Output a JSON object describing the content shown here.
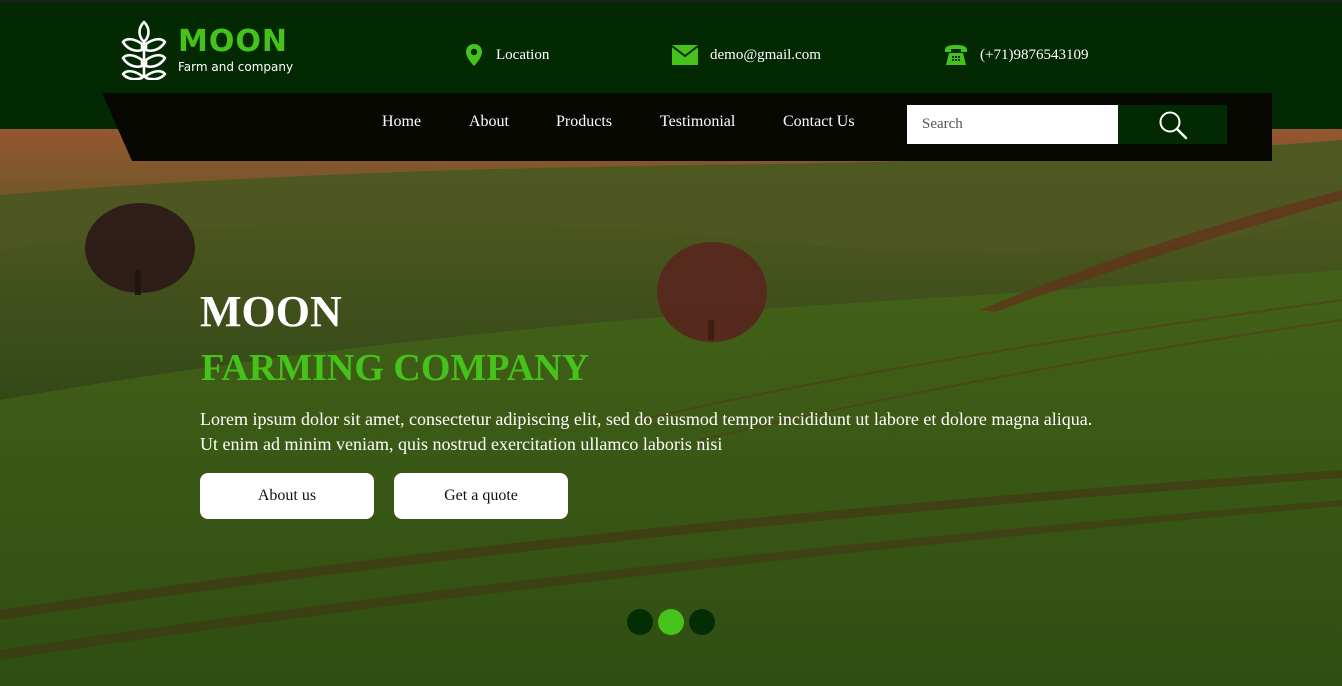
{
  "brand": {
    "title": "MOON",
    "subtitle": "Farm and company",
    "logo_icon": "wheat-icon",
    "accent_color": "#45c31a",
    "dark_color": "#032903"
  },
  "contact": {
    "location": {
      "icon": "map-pin-icon",
      "text": "Location"
    },
    "email": {
      "icon": "envelope-icon",
      "text": "demo@gmail.com"
    },
    "phone": {
      "icon": "telephone-icon",
      "text": "(+71)9876543109"
    }
  },
  "nav": {
    "items": [
      {
        "label": "Home"
      },
      {
        "label": "About"
      },
      {
        "label": "Products"
      },
      {
        "label": "Testimonial"
      },
      {
        "label": "Contact Us"
      }
    ],
    "search_placeholder": "Search",
    "search_icon": "search-icon"
  },
  "hero": {
    "title": "MOON",
    "subtitle": "FARMING COMPANY",
    "text": "Lorem ipsum dolor sit amet, consectetur adipiscing elit, sed do eiusmod tempor incididunt ut labore et dolore magna aliqua. Ut enim ad minim veniam, quis nostrud exercitation ullamco laboris nisi",
    "buttons": {
      "about": "About us",
      "quote": "Get a quote"
    },
    "slider": {
      "count": 3,
      "active_index": 1
    }
  }
}
